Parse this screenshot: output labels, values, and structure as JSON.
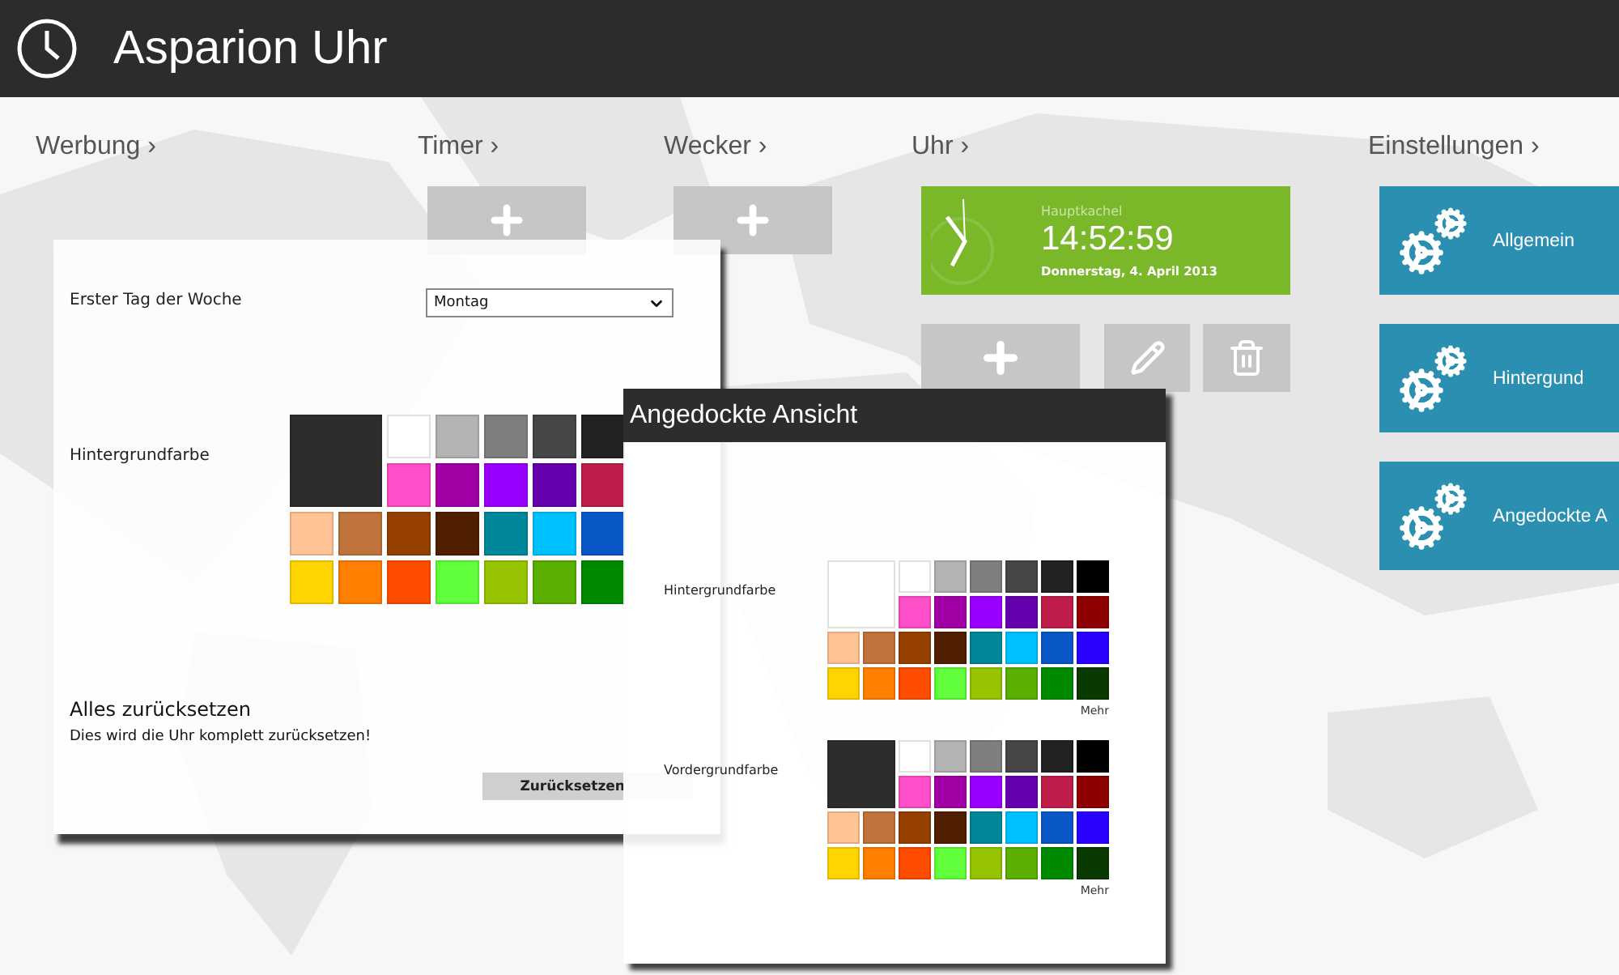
{
  "app": {
    "title": "Asparion Uhr"
  },
  "sections": [
    {
      "kind": "ad",
      "heading": "Werbung ›"
    },
    {
      "kind": "add",
      "heading": "Timer ›"
    },
    {
      "kind": "add",
      "heading": "Wecker ›"
    },
    {
      "kind": "clock",
      "heading": "Uhr ›",
      "tile": {
        "caption": "Hauptkachel",
        "time": "14:52:59",
        "date": "Donnerstag, 4. April 2013"
      }
    },
    {
      "kind": "settings",
      "heading": "Einstellungen ›",
      "tiles": [
        "Allgemein",
        "Hintergund",
        "Angedockte A"
      ]
    }
  ],
  "settings_panel": {
    "first_day": {
      "label": "Erster Tag der Woche",
      "value": "Montag"
    },
    "background": {
      "label": "Hintergrundfarbe",
      "swatches": [
        {
          "kind": "current",
          "color": "#2d2d2d"
        },
        {
          "kind": "swatch",
          "color": "#ffffff"
        },
        {
          "kind": "swatch",
          "color": "#b3b3b3"
        },
        {
          "kind": "swatch",
          "color": "#7f7f7f"
        },
        {
          "kind": "swatch",
          "color": "#464646"
        },
        {
          "kind": "swatch",
          "color": "#222222"
        },
        {
          "kind": "swatch",
          "color": "#ff4fc8"
        },
        {
          "kind": "swatch",
          "color": "#a100a6"
        },
        {
          "kind": "swatch",
          "color": "#9900ff"
        },
        {
          "kind": "swatch",
          "color": "#6400ad"
        },
        {
          "kind": "swatch",
          "color": "#bf1e4b"
        },
        {
          "kind": "swatch",
          "color": "#ffc396"
        },
        {
          "kind": "swatch",
          "color": "#c0733a"
        },
        {
          "kind": "swatch",
          "color": "#964000"
        },
        {
          "kind": "swatch",
          "color": "#4f1f00"
        },
        {
          "kind": "swatch",
          "color": "#00889a"
        },
        {
          "kind": "swatch",
          "color": "#00c1ff"
        },
        {
          "kind": "swatch",
          "color": "#0a58c8"
        },
        {
          "kind": "swatch",
          "color": "#ffd400"
        },
        {
          "kind": "swatch",
          "color": "#ff7f00"
        },
        {
          "kind": "swatch",
          "color": "#ff4d00"
        },
        {
          "kind": "swatch",
          "color": "#61ff3b"
        },
        {
          "kind": "swatch",
          "color": "#96c400"
        },
        {
          "kind": "swatch",
          "color": "#5aaf00"
        },
        {
          "kind": "swatch",
          "color": "#008a00"
        }
      ]
    },
    "reset": {
      "title": "Alles zurücksetzen",
      "text": "Dies wird die Uhr komplett zurücksetzen!",
      "button": "Zurücksetzen"
    }
  },
  "snapped_panel": {
    "title": "Angedockte Ansicht",
    "palettes": [
      {
        "label": "Hintergrundfarbe",
        "more": "Mehr",
        "swatches": [
          {
            "kind": "current",
            "color": "#ffffff"
          },
          {
            "kind": "swatch",
            "color": "#ffffff"
          },
          {
            "kind": "swatch",
            "color": "#b3b3b3"
          },
          {
            "kind": "swatch",
            "color": "#7f7f7f"
          },
          {
            "kind": "swatch",
            "color": "#464646"
          },
          {
            "kind": "swatch",
            "color": "#222222"
          },
          {
            "kind": "swatch",
            "color": "#000000"
          },
          {
            "kind": "swatch",
            "color": "#ff4fc8"
          },
          {
            "kind": "swatch",
            "color": "#a100a6"
          },
          {
            "kind": "swatch",
            "color": "#9900ff"
          },
          {
            "kind": "swatch",
            "color": "#6400ad"
          },
          {
            "kind": "swatch",
            "color": "#bf1e4b"
          },
          {
            "kind": "swatch",
            "color": "#8f0000"
          },
          {
            "kind": "swatch",
            "color": "#ffc396"
          },
          {
            "kind": "swatch",
            "color": "#c0733a"
          },
          {
            "kind": "swatch",
            "color": "#964000"
          },
          {
            "kind": "swatch",
            "color": "#4f1f00"
          },
          {
            "kind": "swatch",
            "color": "#00889a"
          },
          {
            "kind": "swatch",
            "color": "#00c1ff"
          },
          {
            "kind": "swatch",
            "color": "#0a58c8"
          },
          {
            "kind": "swatch",
            "color": "#2a00ff"
          },
          {
            "kind": "swatch",
            "color": "#ffd400"
          },
          {
            "kind": "swatch",
            "color": "#ff7f00"
          },
          {
            "kind": "swatch",
            "color": "#ff4d00"
          },
          {
            "kind": "swatch",
            "color": "#61ff3b"
          },
          {
            "kind": "swatch",
            "color": "#96c400"
          },
          {
            "kind": "swatch",
            "color": "#5aaf00"
          },
          {
            "kind": "swatch",
            "color": "#008a00"
          },
          {
            "kind": "swatch",
            "color": "#0a3a00"
          }
        ]
      },
      {
        "label": "Vordergrundfarbe",
        "more": "Mehr",
        "swatches": [
          {
            "kind": "current",
            "color": "#2d2d2d"
          },
          {
            "kind": "swatch",
            "color": "#ffffff"
          },
          {
            "kind": "swatch",
            "color": "#b3b3b3"
          },
          {
            "kind": "swatch",
            "color": "#7f7f7f"
          },
          {
            "kind": "swatch",
            "color": "#464646"
          },
          {
            "kind": "swatch",
            "color": "#222222"
          },
          {
            "kind": "swatch",
            "color": "#000000"
          },
          {
            "kind": "swatch",
            "color": "#ff4fc8"
          },
          {
            "kind": "swatch",
            "color": "#a100a6"
          },
          {
            "kind": "swatch",
            "color": "#9900ff"
          },
          {
            "kind": "swatch",
            "color": "#6400ad"
          },
          {
            "kind": "swatch",
            "color": "#bf1e4b"
          },
          {
            "kind": "swatch",
            "color": "#8f0000"
          },
          {
            "kind": "swatch",
            "color": "#ffc396"
          },
          {
            "kind": "swatch",
            "color": "#c0733a"
          },
          {
            "kind": "swatch",
            "color": "#964000"
          },
          {
            "kind": "swatch",
            "color": "#4f1f00"
          },
          {
            "kind": "swatch",
            "color": "#00889a"
          },
          {
            "kind": "swatch",
            "color": "#00c1ff"
          },
          {
            "kind": "swatch",
            "color": "#0a58c8"
          },
          {
            "kind": "swatch",
            "color": "#2a00ff"
          },
          {
            "kind": "swatch",
            "color": "#ffd400"
          },
          {
            "kind": "swatch",
            "color": "#ff7f00"
          },
          {
            "kind": "swatch",
            "color": "#ff4d00"
          },
          {
            "kind": "swatch",
            "color": "#61ff3b"
          },
          {
            "kind": "swatch",
            "color": "#96c400"
          },
          {
            "kind": "swatch",
            "color": "#5aaf00"
          },
          {
            "kind": "swatch",
            "color": "#008a00"
          },
          {
            "kind": "swatch",
            "color": "#0a3a00"
          }
        ]
      }
    ]
  }
}
